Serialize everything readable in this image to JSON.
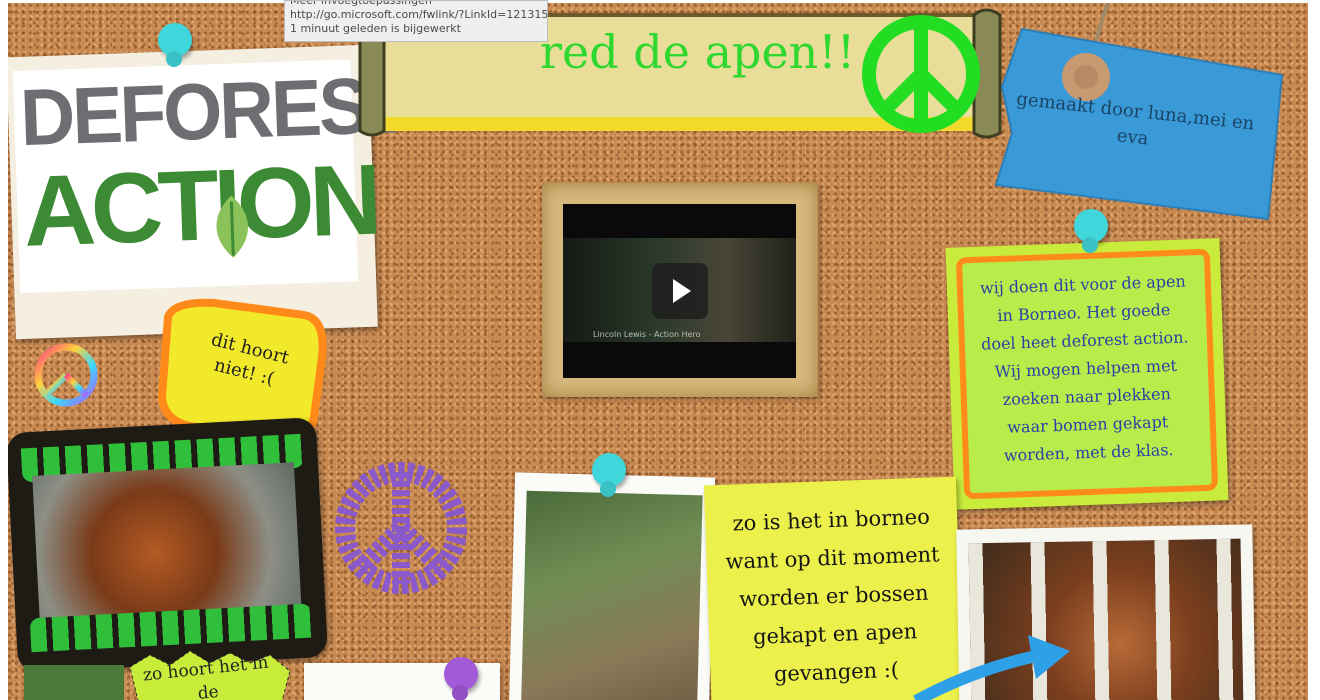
{
  "tooltip": {
    "line1": "Meer invoegtoepassingen",
    "line2": "http://go.microsoft.com/fwlink/?LinkId=121315",
    "line3": "1 minuut geleden is bijgewerkt"
  },
  "banner": {
    "title": "red de apen!!",
    "title_color": "#2ed82e"
  },
  "logo": {
    "line1": "DEFOREST",
    "line2": "ACTION",
    "line1_color": "#6d6e71",
    "line2_color": "#3c8a34"
  },
  "tag": {
    "text": "gemaakt door luna,mei en eva",
    "color": "#3a9ad8"
  },
  "note_green": {
    "text": "wij doen dit voor de apen in Borneo. Het goede doel heet deforest action. Wij mogen helpen met zoeken naar plekken waar bomen gekapt worden, met de klas."
  },
  "speech_bubble": {
    "text": "dit hoort niet! :("
  },
  "note_yellow": {
    "text": "zo is het in borneo want op dit moment worden er bossen gekapt en apen gevangen :("
  },
  "video": {
    "caption": "Lincoln Lewis - Action Hero"
  },
  "burst": {
    "text": "zo hoort het in de"
  },
  "icons": [
    "peace-icon-green",
    "peace-icon-rainbow",
    "peace-icon-purple",
    "play-icon",
    "pushpin-icon"
  ]
}
